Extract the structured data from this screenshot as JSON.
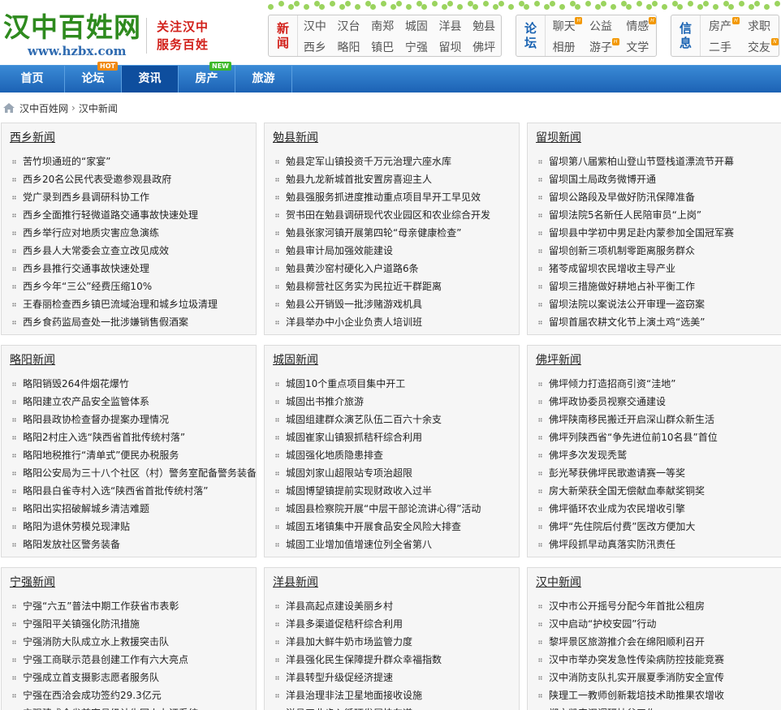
{
  "logo": {
    "name": "汉中百姓网",
    "url": "www.hzbx.com"
  },
  "slogan": {
    "line1": "关注汉中",
    "line2": "服务百姓"
  },
  "quick_news": {
    "title_top": "新",
    "title_bottom": "闻",
    "links": [
      "汉中",
      "汉台",
      "南郑",
      "城固",
      "洋县",
      "勉县",
      "西乡",
      "略阳",
      "镇巴",
      "宁强",
      "留坝",
      "佛坪"
    ]
  },
  "quick_forum": {
    "title_top": "论",
    "title_bottom": "坛",
    "links": [
      "聊天",
      "公益",
      "情感",
      "相册",
      "游子",
      "文学"
    ]
  },
  "quick_info": {
    "title_top": "信",
    "title_bottom": "息",
    "links": [
      "房产",
      "求职",
      "二手",
      "交友"
    ]
  },
  "nav": {
    "items": [
      "首页",
      "论坛",
      "资讯",
      "房产",
      "旅游"
    ],
    "badges": {
      "hot": "HOT",
      "new": "NEW"
    }
  },
  "breadcrumb": {
    "home": "汉中百姓网",
    "current": "汉中新闻"
  },
  "panels": [
    {
      "title": "西乡新闻",
      "items": [
        "苦竹坝通班的“家宴”",
        "西乡20名公民代表受邀参观县政府",
        "党广录到西乡县调研科协工作",
        "西乡全面推行轻微道路交通事故快速处理",
        "西乡举行应对地质灾害应急演练",
        "西乡县人大常委会立查立改见成效",
        "西乡县推行交通事故快速处理",
        "西乡今年“三公”经费压缩10%",
        "王春丽检查西乡镇巴流域治理和城乡垃圾清理",
        "西乡食药监局查处一批涉嫌销售假酒案"
      ]
    },
    {
      "title": "勉县新闻",
      "items": [
        "勉县定军山镇投资千万元治理六座水库",
        "勉县九龙新城首批安置房喜迎主人",
        "勉县强服务抓进度推动重点项目早开工早见效",
        "贺书田在勉县调研现代农业园区和农业综合开发",
        "勉县张家河镇开展第四轮“母亲健康检查”",
        "勉县审计局加强效能建设",
        "勉县黄沙窑村硬化入户道路6条",
        "勉县柳营社区务实为民拉近干群距离",
        "勉县公开销毁一批涉赌游戏机具",
        "洋县举办中小企业负责人培训班"
      ]
    },
    {
      "title": "留坝新闻",
      "items": [
        "留坝第八届紫柏山登山节暨栈道漂流节开幕",
        "留坝国土局政务微博开通",
        "留坝公路段及早做好防汛保障准备",
        "留坝法院5名新任人民陪审员“上岗”",
        "留坝县中学初中男足赴内蒙参加全国冠军赛",
        "留坝创新三项机制零距离服务群众",
        "猪苓成留坝农民增收主导产业",
        "留坝三措施做好耕地占补平衡工作",
        "留坝法院以案说法公开审理一盗窃案",
        "留坝首届农耕文化节上演土鸡“选美”"
      ]
    },
    {
      "title": "略阳新闻",
      "items": [
        "略阳销毁264件烟花爆竹",
        "略阳建立农产品安全监管体系",
        "略阳县政协检查督办提案办理情况",
        "略阳2村庄入选“陕西省首批传统村落”",
        "略阳地税推行“清单式”便民办税服务",
        "略阳公安局为三十八个社区（村）警务室配备警务装备",
        "略阳县白雀寺村入选“陕西省首批传统村落”",
        "略阳出实招破解城乡清洁难题",
        "略阳为退休劳模兑现津贴",
        "略阳发放社区警务装备"
      ]
    },
    {
      "title": "城固新闻",
      "items": [
        "城固10个重点项目集中开工",
        "城固出书推介旅游",
        "城固组建群众演艺队伍二百六十余支",
        "城固崔家山镇狠抓秸秆综合利用",
        "城固强化地质隐患排查",
        "城固刘家山超限站专项治超限",
        "城固博望镇提前实现财政收入过半",
        "城固县检察院开展“中层干部论流讲心得”活动",
        "城固五堵镇集中开展食品安全风险大排查",
        "城固工业增加值增速位列全省第八"
      ]
    },
    {
      "title": "佛坪新闻",
      "items": [
        "佛坪倾力打造招商引资“洼地”",
        "佛坪政协委员视察交通建设",
        "佛坪陕南移民搬迁开启深山群众新生活",
        "佛坪列陕西省“争先进位前10名县”首位",
        "佛坪多次发现秃鹫",
        "彭光琴获佛坪民歌邀请赛一等奖",
        "房大新荣获全国无偿献血奉献奖铜奖",
        "佛坪循环农业成为农民增收引擎",
        "佛坪“先住院后付费”医改方便加大",
        "佛坪段抓早动真落实防汛责任"
      ]
    },
    {
      "title": "宁强新闻",
      "items": [
        "宁强“六五”普法中期工作获省市表彰",
        "宁强阳平关镇强化防汛措施",
        "宁强消防大队成立水上救援突击队",
        "宁强工商联示范县创建工作有六大亮点",
        "宁强成立首支摄影志愿者服务队",
        "宁强在西洽会成功签约29.3亿元",
        "宁强建成全省首家县级计生网上办证系统"
      ]
    },
    {
      "title": "洋县新闻",
      "items": [
        "洋县高起点建设美丽乡村",
        "洋县多渠道促秸秆综合利用",
        "洋县加大鲜牛奶市场监管力度",
        "洋县强化民生保障提升群众幸福指数",
        "洋县转型升级促经济提速",
        "洋县治理非法卫星地面接收设施",
        "洋县工业步入循环发展快车道"
      ]
    },
    {
      "title": "汉中新闻",
      "items": [
        "汉中市公开摇号分配今年首批公租房",
        "汉中启动“护校安园”行动",
        "黎坪景区旅游推介会在绵阳顺利召开",
        "汉中市举办突发急性传染病防控技能竞赛",
        "汉中消防支队扎实开展夏季消防安全宣传",
        "陕理工一教师创新栽培技术助推果农增收",
        "郑文凯来汉调研扶贫工作"
      ]
    }
  ],
  "colors": {
    "nav_top": "#3a8ad6",
    "nav_bottom": "#1c62b4",
    "logo_green": "#2e8a1e",
    "slogan_red": "#d2211b",
    "panel_bg": "#f6f6f6"
  }
}
